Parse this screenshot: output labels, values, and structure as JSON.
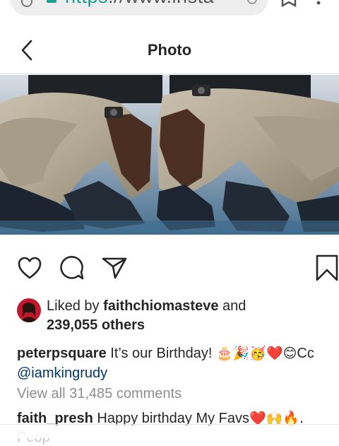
{
  "browser": {
    "url_scheme": "https",
    "url_rest": "://www.insta"
  },
  "header": {
    "title": "Photo"
  },
  "post": {
    "likes": {
      "liked_by_prefix": "Liked by",
      "liker_username": "faithchiomasteve",
      "and_text": "and",
      "others_text": "239,055 others"
    },
    "caption": {
      "author": "peterpsquare",
      "text": "It’s our Birthday!",
      "emojis": "🎂🎉🥳❤️😊",
      "suffix": "Cc",
      "mention": "@iamkingrudy"
    },
    "view_comments": "View all 31,485 comments",
    "comments": [
      {
        "author": "faith_presh",
        "text": "Happy birthday My Favs",
        "emojis": "❤️🙌🔥."
      },
      {
        "author": "",
        "text": "Peop"
      }
    ]
  },
  "colors": {
    "accent_teal": "#1a9e8f",
    "mention_blue": "#00376b",
    "muted_gray": "#8e8e8e"
  },
  "icons": [
    "info-icon",
    "lock-icon",
    "reload-icon",
    "star-icon",
    "menu-icon",
    "back-icon",
    "heart-icon",
    "comment-icon",
    "share-icon",
    "bookmark-icon"
  ]
}
